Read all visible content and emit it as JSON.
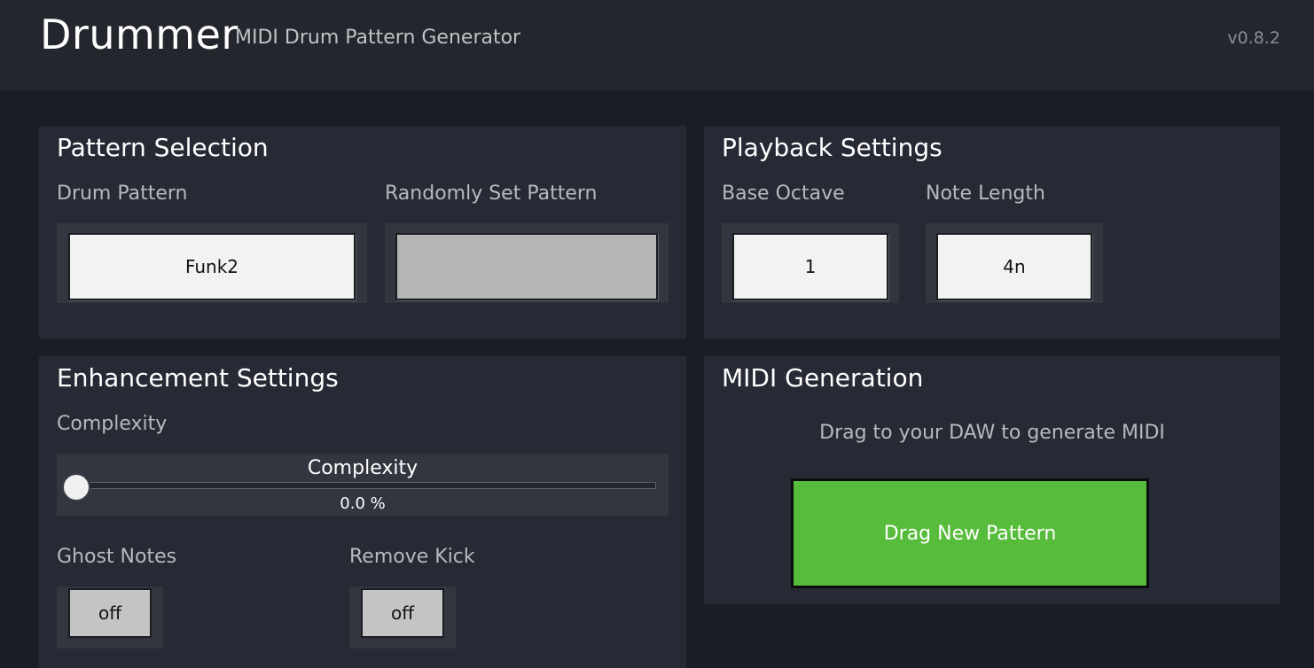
{
  "header": {
    "title": "Drummer",
    "subtitle": "MIDI Drum Pattern Generator",
    "version": "v0.8.2"
  },
  "pattern_selection": {
    "title": "Pattern Selection",
    "drum_pattern_label": "Drum Pattern",
    "drum_pattern_value": "Funk2",
    "random_pattern_label": "Randomly Set Pattern",
    "random_pattern_value": ""
  },
  "playback_settings": {
    "title": "Playback Settings",
    "base_octave_label": "Base Octave",
    "base_octave_value": "1",
    "note_length_label": "Note Length",
    "note_length_value": "4n"
  },
  "enhancement_settings": {
    "title": "Enhancement Settings",
    "complexity_label": "Complexity",
    "complexity_slider_title": "Complexity",
    "complexity_value_text": "0.0 %",
    "complexity_fraction": 0.0,
    "ghost_notes_label": "Ghost Notes",
    "ghost_notes_value": "off",
    "remove_kick_label": "Remove Kick",
    "remove_kick_value": "off"
  },
  "midi_generation": {
    "title": "MIDI Generation",
    "hint": "Drag to your DAW to generate MIDI",
    "drag_button_label": "Drag New Pattern"
  },
  "colors": {
    "background": "#1a1d23",
    "panel": "#272a34",
    "accent_green": "#57bc3b"
  }
}
